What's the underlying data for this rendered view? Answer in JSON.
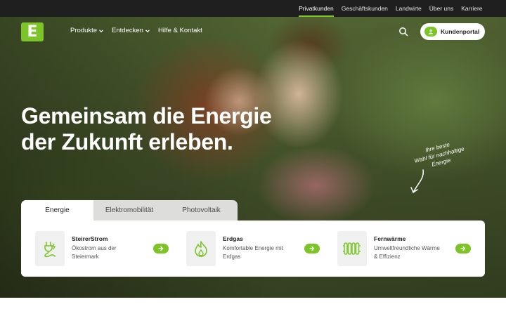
{
  "colors": {
    "accent": "#7cc427",
    "topbar": "#1f1f1f",
    "text": "#1f1f1f"
  },
  "logo": {
    "letter": "E"
  },
  "top_nav": [
    {
      "label": "Privatkunden",
      "active": true
    },
    {
      "label": "Geschäftskunden",
      "active": false
    },
    {
      "label": "Landwirte",
      "active": false
    },
    {
      "label": "Über uns",
      "active": false
    },
    {
      "label": "Karriere",
      "active": false
    }
  ],
  "main_nav": [
    {
      "label": "Produkte",
      "icon": "chevron-down-icon"
    },
    {
      "label": "Entdecken",
      "icon": "chevron-down-icon"
    },
    {
      "label": "Hilfe & Kontakt"
    }
  ],
  "header": {
    "search_icon": "search-icon",
    "portal_label": "Kundenportal",
    "portal_icon": "user-icon"
  },
  "hero": {
    "headline_line1": "Gemeinsam die Energie",
    "headline_line2": "der Zukunft erleben.",
    "tagline_line1": "Ihre beste",
    "tagline_line2": "Wahl für nachhaltige",
    "tagline_line3": "Energie"
  },
  "tabs": [
    {
      "label": "Energie",
      "active": true
    },
    {
      "label": "Elektromobilität",
      "active": false
    },
    {
      "label": "Photovoltaik",
      "active": false
    }
  ],
  "products": [
    {
      "title": "SteirerStrom",
      "desc": "Ökostrom aus der Steiermark",
      "icon": "plug-icon"
    },
    {
      "title": "Erdgas",
      "desc": "Komfortable Energie mit Erdgas",
      "icon": "flame-icon"
    },
    {
      "title": "Fernwärme",
      "desc": "Umweltfreundliche Wärme & Effizienz",
      "icon": "radiator-icon"
    }
  ]
}
